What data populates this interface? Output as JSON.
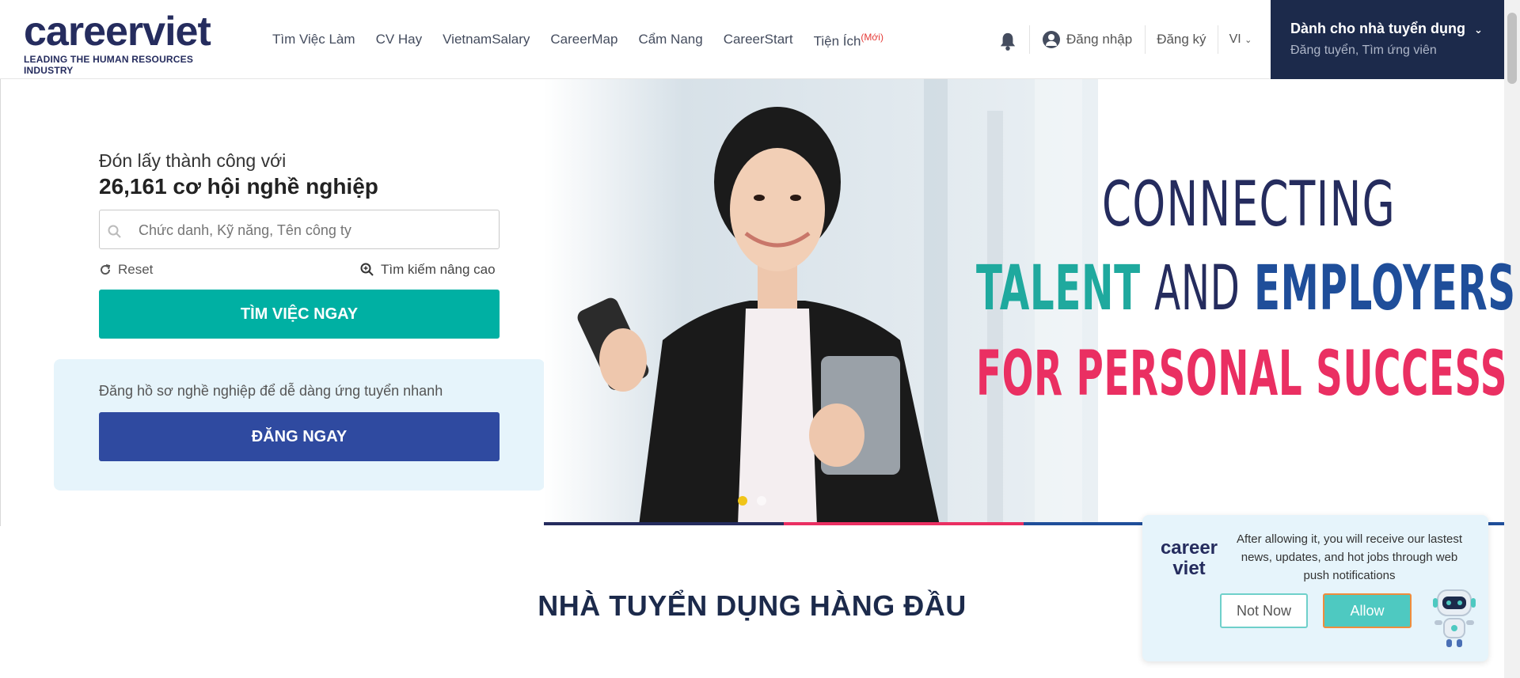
{
  "header": {
    "logo_text": "careerviet",
    "logo_tagline": "LEADING THE HUMAN RESOURCES INDUSTRY",
    "nav": [
      {
        "label": "Tìm Việc Làm"
      },
      {
        "label": "CV Hay"
      },
      {
        "label": "VietnamSalary"
      },
      {
        "label": "CareerMap"
      },
      {
        "label": "Cẩm Nang"
      },
      {
        "label": "CareerStart"
      },
      {
        "label": "Tiện Ích",
        "badge": "(Mới)"
      }
    ],
    "login_label": "Đăng nhập",
    "register_label": "Đăng ký",
    "language": "VI",
    "employer_title": "Dành cho nhà tuyển dụng",
    "employer_sub": "Đăng tuyển, Tìm ứng viên"
  },
  "hero": {
    "headline_line1": "Đón lấy thành công với",
    "headline_line2": "26,161 cơ hội nghề nghiệp",
    "search_placeholder": "Chức danh, Kỹ năng, Tên công ty",
    "reset_label": "Reset",
    "advanced_search_label": "Tìm kiếm nâng cao",
    "search_button": "TÌM VIỆC NGAY",
    "register_prompt": "Đăng hồ sơ nghề nghiệp để dễ dàng ứng tuyển nhanh",
    "register_button": "ĐĂNG NGAY"
  },
  "banner": {
    "line1": "CONNECTING",
    "line2_part1": "TALENT",
    "line2_part2": "AND",
    "line2_part3": "EMPLOYERS",
    "line3": "FOR PERSONAL SUCCESS",
    "active_slide": 1,
    "slide_count": 2
  },
  "section": {
    "title": "NHÀ TUYỂN DỤNG HÀNG ĐẦU"
  },
  "notification": {
    "logo_line1": "career",
    "logo_line2": "viet",
    "message": "After allowing it, you will receive our lastest news, updates, and hot jobs through web push notifications",
    "not_now_label": "Not Now",
    "allow_label": "Allow"
  },
  "colors": {
    "brand_navy": "#252c5e",
    "teal": "#00b0a3",
    "blue_button": "#2f4aa0",
    "pink": "#ea2f62",
    "employer_bg": "#1c2a4b"
  },
  "icons": [
    "bell-icon",
    "user-icon",
    "search-icon",
    "reset-icon",
    "magnifier-plus-icon",
    "chevron-down-icon",
    "robot-mascot"
  ]
}
